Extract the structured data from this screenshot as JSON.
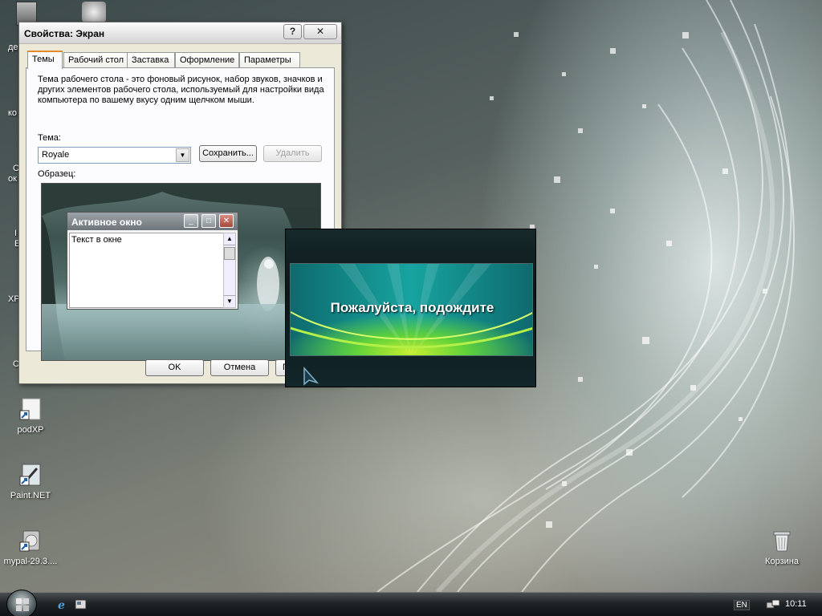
{
  "desktop": {
    "icons": [
      {
        "label": "podXP"
      },
      {
        "label": "Paint.NET"
      },
      {
        "label": "mypal-29.3...."
      },
      {
        "label": "Корзина"
      }
    ],
    "partial_labels": [
      "де",
      "ко",
      "С",
      "ок",
      "I",
      "E",
      "XP",
      "С"
    ]
  },
  "dialog": {
    "title": "Свойства: Экран",
    "help_btn": "?",
    "close_btn": "✕",
    "tabs": [
      "Темы",
      "Рабочий стол",
      "Заставка",
      "Оформление",
      "Параметры"
    ],
    "description": "Тема рабочего стола - это фоновый рисунок, набор звуков, значков и других элементов рабочего стола, используемый для настройки вида компьютера по вашему вкусу одним щелчком мыши.",
    "theme_label": "Тема:",
    "theme_value": "Royale",
    "save_button": "Сохранить...",
    "delete_button": "Удалить",
    "sample_label": "Образец:",
    "preview": {
      "window_title": "Активное окно",
      "window_text": "Текст в окне"
    },
    "ok_button": "OK",
    "cancel_button": "Отмена",
    "apply_button_partial": "П"
  },
  "splash": {
    "message": "Пожалуйста, подождите"
  },
  "taskbar": {
    "language": "EN",
    "clock": "10:11"
  }
}
